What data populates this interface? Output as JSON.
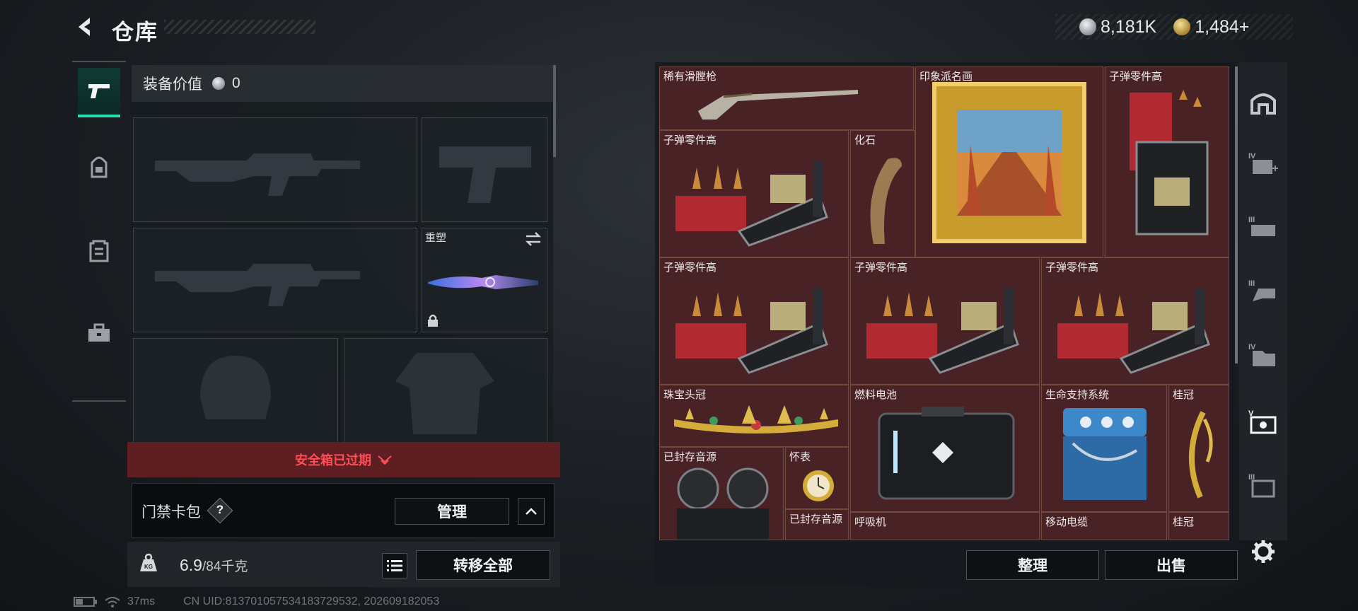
{
  "header": {
    "title": "仓库",
    "back_icon": "back-arrow-icon"
  },
  "currency": {
    "silver": "8,181K",
    "gold": "1,484+",
    "add_symbol": "+"
  },
  "left_tabs": [
    {
      "name": "weapon",
      "icon": "pistol-icon",
      "active": true
    },
    {
      "name": "backpack",
      "icon": "backpack-icon",
      "active": false
    },
    {
      "name": "rig",
      "icon": "vest-icon",
      "active": false
    },
    {
      "name": "toolbox",
      "icon": "toolbox-icon",
      "active": false
    }
  ],
  "equipment": {
    "value_label": "装备价值",
    "value": "0",
    "slots": [
      {
        "label": "",
        "placeholder": "primary-rifle"
      },
      {
        "label": "",
        "placeholder": "pistol"
      },
      {
        "label": "",
        "placeholder": "secondary-rifle"
      },
      {
        "label": "重塑",
        "placeholder": "melee-knife"
      },
      {
        "label": "",
        "placeholder": "helmet"
      },
      {
        "label": "",
        "placeholder": "armor"
      }
    ]
  },
  "safe_box": {
    "label": "安全箱已过期"
  },
  "keycard": {
    "label": "门禁卡包",
    "help": "?",
    "manage_label": "管理"
  },
  "capacity": {
    "current": "6.9",
    "max": "/84千克"
  },
  "transfer_all_label": "转移全部",
  "stash": {
    "items": [
      {
        "name": "稀有滑膛枪",
        "kind": "musket"
      },
      {
        "name": "印象派名画",
        "kind": "painting"
      },
      {
        "name": "子弹零件高",
        "kind": "ammo-tall"
      },
      {
        "name": "子弹零件高",
        "kind": "ammo"
      },
      {
        "name": "化石",
        "kind": "fossil"
      },
      {
        "name": "子弹零件高",
        "kind": "ammo"
      },
      {
        "name": "子弹零件高",
        "kind": "ammo"
      },
      {
        "name": "子弹零件高",
        "kind": "ammo"
      },
      {
        "name": "珠宝头冠",
        "kind": "tiara"
      },
      {
        "name": "燃料电池",
        "kind": "fuel-cell"
      },
      {
        "name": "生命支持系统",
        "kind": "life-support"
      },
      {
        "name": "桂冠",
        "kind": "laurel"
      },
      {
        "name": "已封存音源",
        "kind": "reel"
      },
      {
        "name": "怀表",
        "kind": "pocket-watch"
      },
      {
        "name": "已封存音源",
        "kind": "reel"
      },
      {
        "name": "呼吸机",
        "kind": "ventilator"
      },
      {
        "name": "移动电缆",
        "kind": "cable"
      },
      {
        "name": "桂冠",
        "kind": "laurel"
      }
    ]
  },
  "stash_buttons": {
    "sort": "整理",
    "sell": "出售"
  },
  "right_tabs": [
    {
      "icon": "bunker-icon"
    },
    {
      "icon": "case-iv-icon",
      "tier": "IV"
    },
    {
      "icon": "case-iii-icon",
      "tier": "III"
    },
    {
      "icon": "case-iii-b-icon",
      "tier": "III"
    },
    {
      "icon": "case-iv-b-icon",
      "tier": "IV"
    },
    {
      "icon": "case-v-icon",
      "tier": "V",
      "active": true
    },
    {
      "icon": "case-iii-c-icon",
      "tier": "III"
    }
  ],
  "status": {
    "ping": "37ms",
    "uid": "CN UID:813701057534183729532, 202609182053"
  },
  "colors": {
    "accent": "#27e0b1",
    "alert": "#ff4d57",
    "stash": "#4b2428"
  }
}
